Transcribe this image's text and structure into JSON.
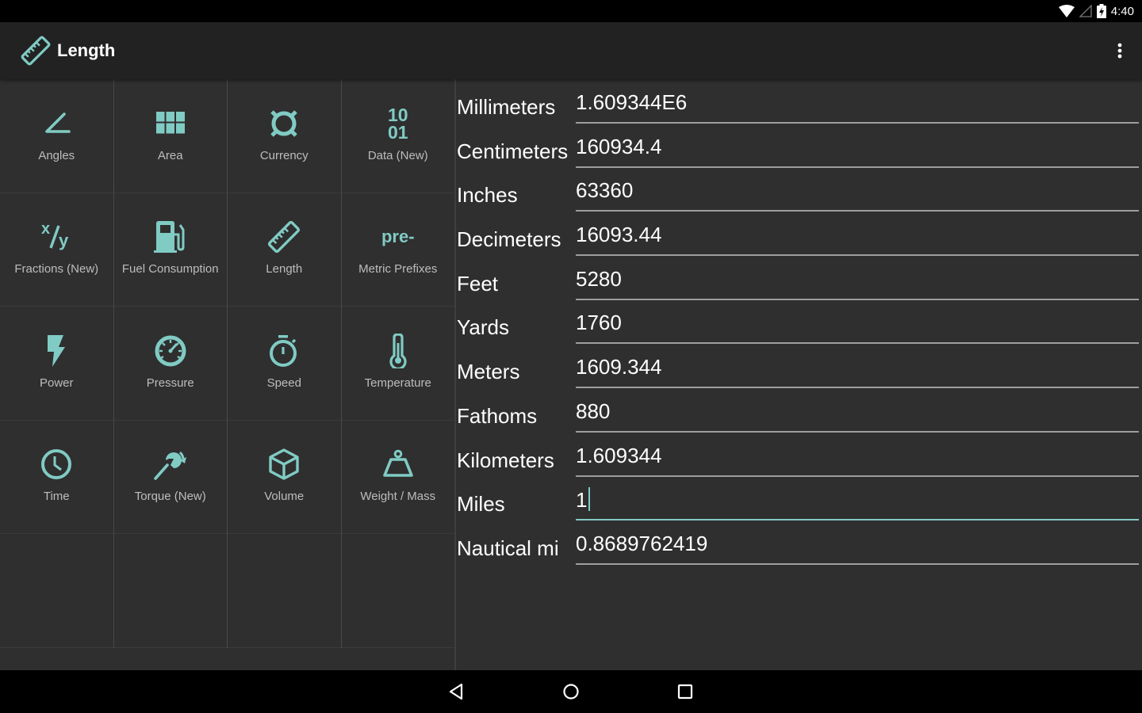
{
  "status_bar": {
    "time": "4:40",
    "icons": [
      "wifi-icon",
      "cell-signal-icon",
      "battery-charging-icon"
    ]
  },
  "app_bar": {
    "title": "Length",
    "icon": "ruler-icon",
    "menu_icon": "more-vert-icon"
  },
  "accent_color": "#80cbc4",
  "categories": [
    {
      "label": "Angles",
      "icon": "angle-icon"
    },
    {
      "label": "Area",
      "icon": "grid-icon"
    },
    {
      "label": "Currency",
      "icon": "currency-icon"
    },
    {
      "label": "Data (New)",
      "icon": "binary-data-icon",
      "icon_text_top": "10",
      "icon_text_bottom": "01"
    },
    {
      "label": "Fractions (New)",
      "icon": "fraction-icon"
    },
    {
      "label": "Fuel Consumption",
      "icon": "fuel-pump-icon"
    },
    {
      "label": "Length",
      "icon": "ruler-icon"
    },
    {
      "label": "Metric Prefixes",
      "icon": "prefix-icon",
      "icon_text": "pre-"
    },
    {
      "label": "Power",
      "icon": "lightning-icon"
    },
    {
      "label": "Pressure",
      "icon": "gauge-icon"
    },
    {
      "label": "Speed",
      "icon": "stopwatch-icon"
    },
    {
      "label": "Temperature",
      "icon": "thermometer-icon"
    },
    {
      "label": "Time",
      "icon": "clock-icon"
    },
    {
      "label": "Torque (New)",
      "icon": "wrench-rotate-icon"
    },
    {
      "label": "Volume",
      "icon": "cube-icon"
    },
    {
      "label": "Weight / Mass",
      "icon": "weight-icon"
    }
  ],
  "units": [
    {
      "name": "Millimeters",
      "value": "1.609344E6"
    },
    {
      "name": "Centimeters",
      "value": "160934.4"
    },
    {
      "name": "Inches",
      "value": "63360"
    },
    {
      "name": "Decimeters",
      "value": "16093.44"
    },
    {
      "name": "Feet",
      "value": "5280"
    },
    {
      "name": "Yards",
      "value": "1760"
    },
    {
      "name": "Meters",
      "value": "1609.344"
    },
    {
      "name": "Fathoms",
      "value": "880"
    },
    {
      "name": "Kilometers",
      "value": "1.609344"
    },
    {
      "name": "Miles",
      "value": "1",
      "focused": true
    },
    {
      "name": "Nautical mi",
      "value": "0.8689762419"
    }
  ],
  "nav_bar": {
    "buttons": [
      "back-icon",
      "home-icon",
      "recents-icon"
    ]
  }
}
